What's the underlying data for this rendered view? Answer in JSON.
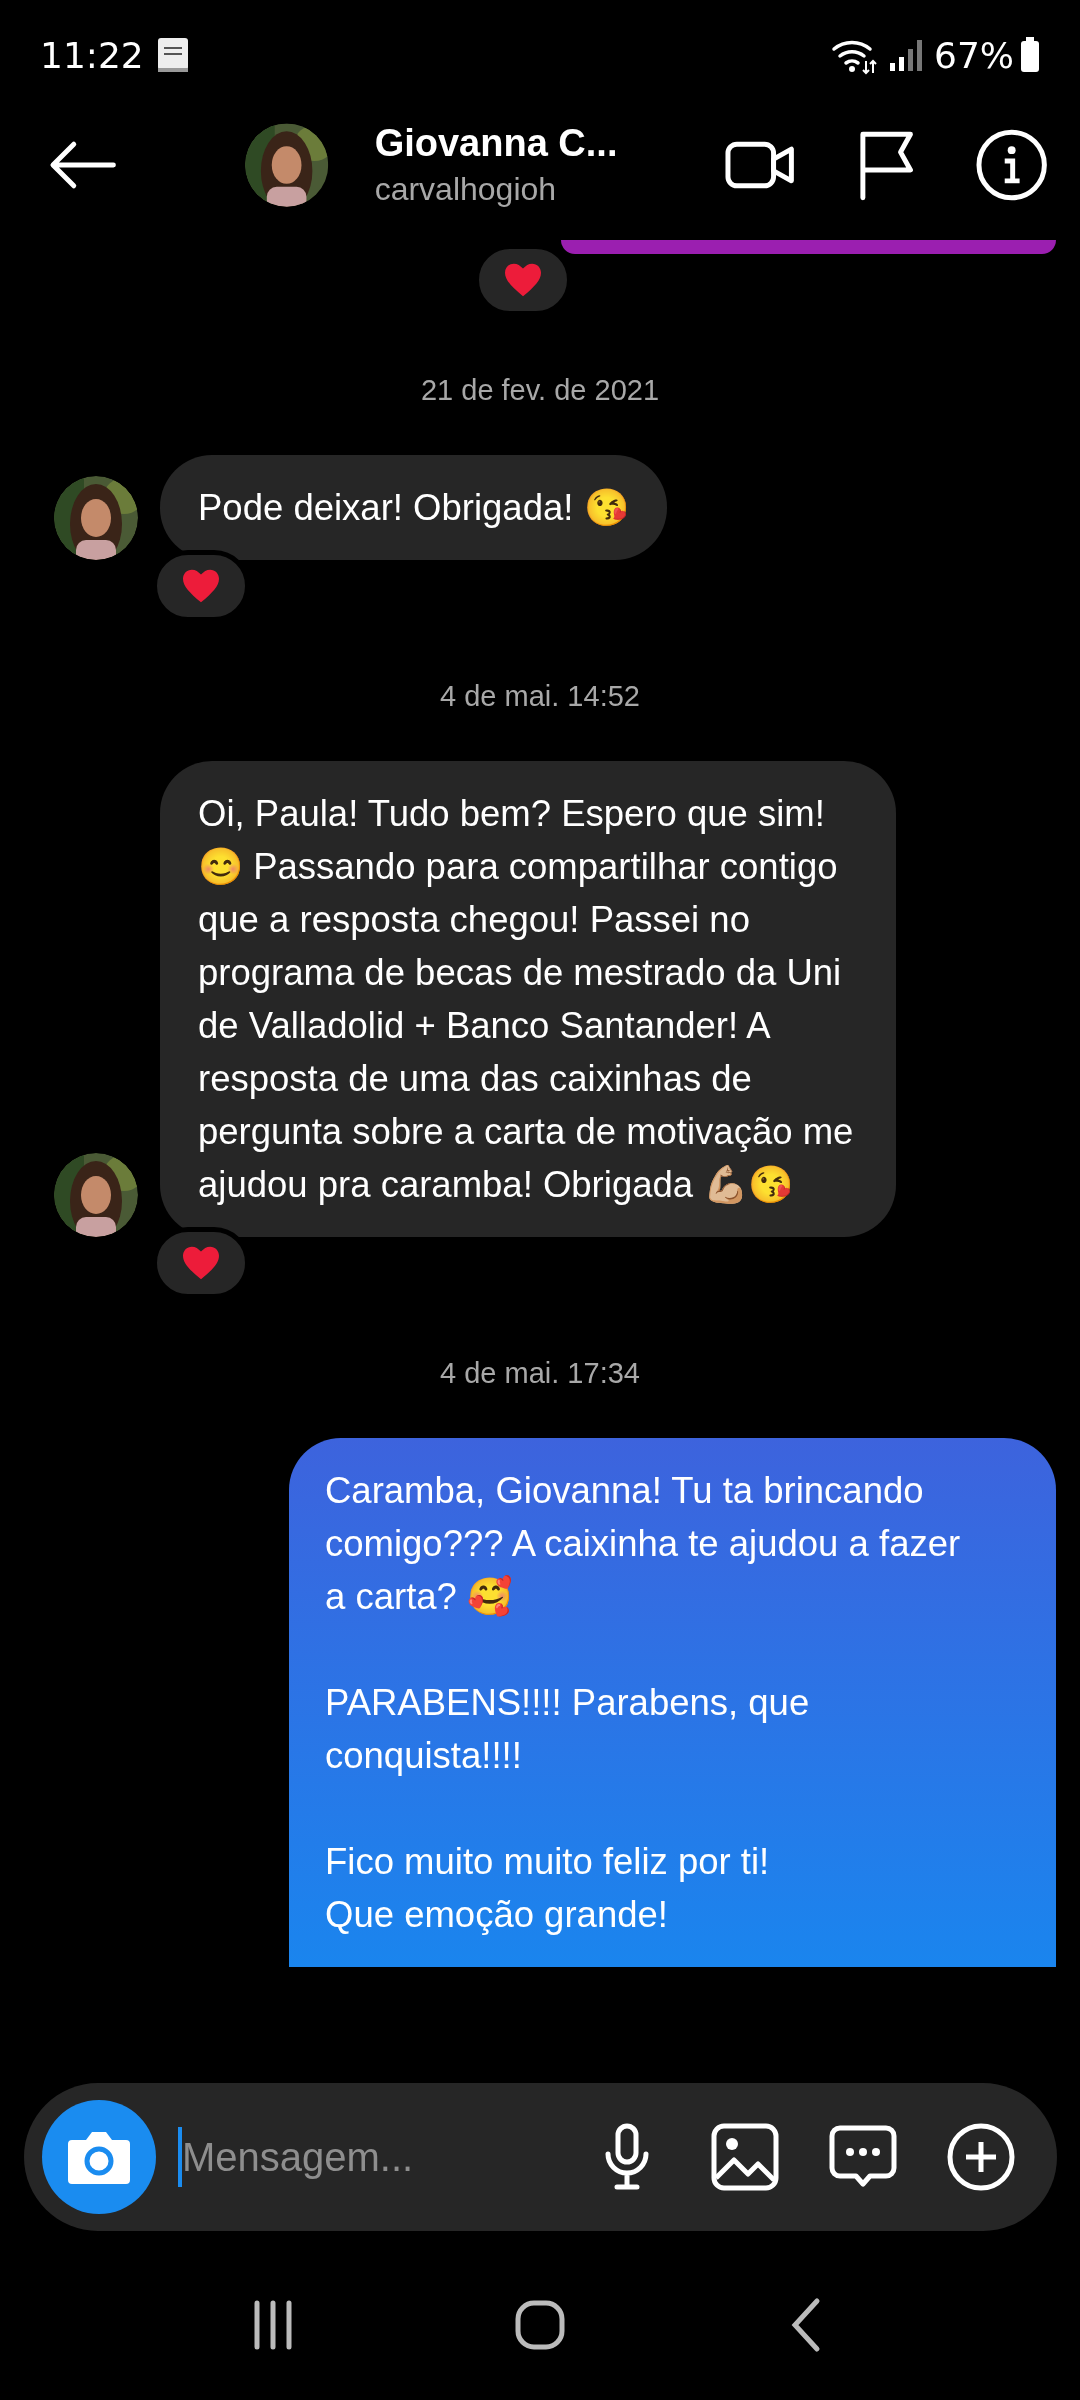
{
  "status_bar": {
    "time": "11:22",
    "battery": "67%"
  },
  "header": {
    "name": "Giovanna C...",
    "username": "carvalhogioh"
  },
  "top_reaction": {
    "reacted": true
  },
  "items": [
    {
      "kind": "date",
      "text": "21 de fev. de 2021"
    },
    {
      "kind": "incoming",
      "text": "Pode deixar! Obrigada! 😘",
      "reacted": true
    },
    {
      "kind": "date",
      "text": "4 de mai. 14:52"
    },
    {
      "kind": "incoming",
      "text": "Oi, Paula! Tudo bem? Espero que sim! 😊 Passando para compartilhar contigo que a resposta chegou! Passei no programa de becas de mestrado da Uni de Valladolid + Banco Santander! A resposta de uma das caixinhas de pergunta sobre a carta de motivação me ajudou pra caramba! Obrigada 💪🏼😘",
      "reacted": true
    },
    {
      "kind": "date",
      "text": "4 de mai. 17:34"
    },
    {
      "kind": "outgoing",
      "text": "Caramba, Giovanna! Tu ta brincando comigo??? A caixinha te ajudou a fazer a carta? 🥰\n\nPARABENS!!!! Parabens, que conquista!!!!\n\nFico muito muito feliz por ti!\nQue emoção grande!",
      "reacted": false
    }
  ],
  "composer": {
    "placeholder": "Mensagem..."
  }
}
